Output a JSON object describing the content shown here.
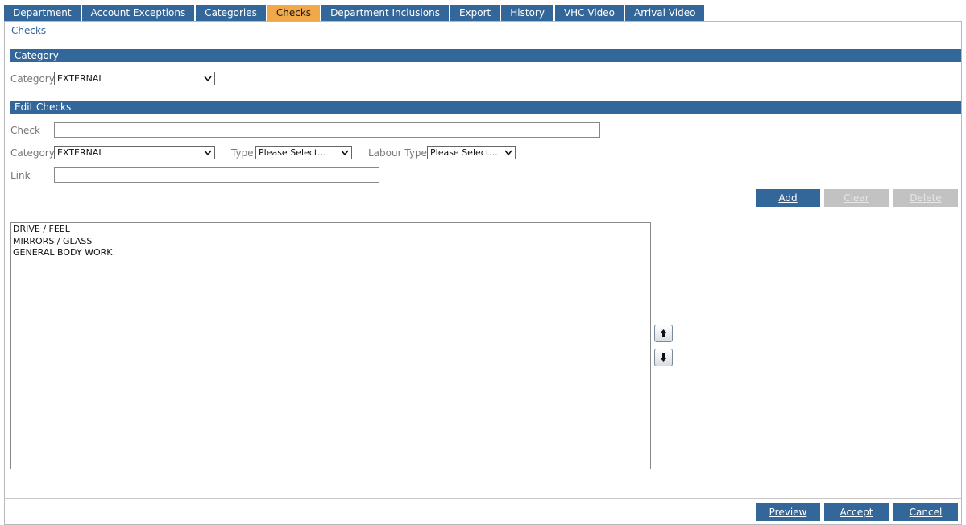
{
  "tabs": [
    {
      "label": "Department"
    },
    {
      "label": "Account Exceptions"
    },
    {
      "label": "Categories"
    },
    {
      "label": "Checks",
      "active": true
    },
    {
      "label": "Department Inclusions"
    },
    {
      "label": "Export"
    },
    {
      "label": "History"
    },
    {
      "label": "VHC Video"
    },
    {
      "label": "Arrival Video"
    }
  ],
  "page_title": "Checks",
  "category_section": {
    "header": "Category",
    "category_label": "Category",
    "category_value": "EXTERNAL"
  },
  "edit_section": {
    "header": "Edit Checks",
    "check_label": "Check",
    "check_value": "",
    "category_label": "Category",
    "category_value": "EXTERNAL",
    "type_label": "Type",
    "type_value": "Please Select...",
    "labour_type_label": "Labour Type",
    "labour_type_value": "Please Select...",
    "link_label": "Link",
    "link_value": "",
    "add_label": "Add",
    "clear_label": "Clear",
    "delete_label": "Delete"
  },
  "checks_list": [
    "DRIVE / FEEL",
    "MIRRORS / GLASS",
    "GENERAL BODY WORK"
  ],
  "icons": {
    "move_up": "arrow-up-icon",
    "move_down": "arrow-down-icon",
    "dropdown": "chevron-down-icon"
  },
  "footer": {
    "preview_label": "Preview",
    "accept_label": "Accept",
    "cancel_label": "Cancel"
  },
  "colors": {
    "tab": "#336699",
    "tab_active": "#f0a848",
    "section_bar": "#336699",
    "button": "#336699",
    "button_disabled": "#c2c2c2"
  }
}
